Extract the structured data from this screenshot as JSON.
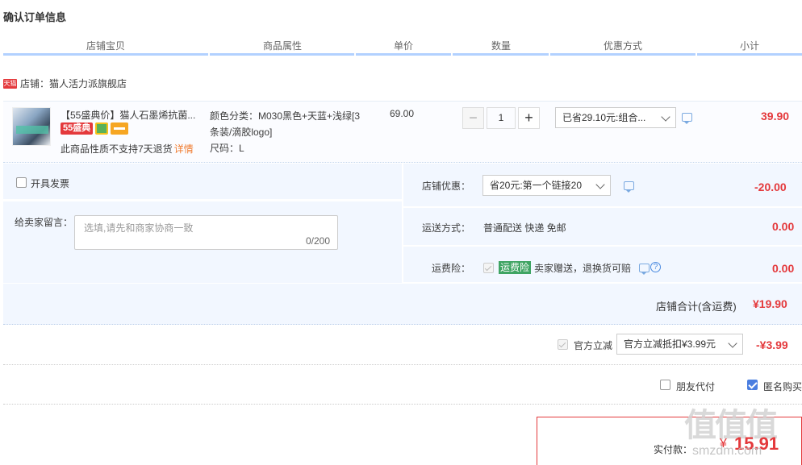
{
  "page_title": "确认订单信息",
  "columns": [
    "店铺宝贝",
    "商品属性",
    "单价",
    "数量",
    "优惠方式",
    "小计"
  ],
  "shop": {
    "icon_text": "天猫",
    "label": "店铺：猫人活力派旗舰店"
  },
  "item": {
    "title": "【55盛典价】猫人石墨烯抗菌...",
    "badge": "55盛典",
    "no_return": "此商品性质不支持7天退货",
    "detail_link": "详情",
    "attr_color": "颜色分类：M030黑色+天蓝+浅绿[3条装/滴胶logo]",
    "attr_size": "尺码：L",
    "price": "69.00",
    "quantity": "1",
    "qty_minus": "−",
    "qty_plus": "+",
    "discount_select": "已省29.10元:组合...",
    "subtotal": "39.90"
  },
  "invoice": {
    "label": "开具发票"
  },
  "message": {
    "label": "给卖家留言：",
    "placeholder": "选填,请先和商家协商一致",
    "counter": "0/200"
  },
  "store_discount": {
    "label": "店铺优惠：",
    "select": "省20元:第一个链接20",
    "amount": "-20.00"
  },
  "shipping": {
    "label": "运送方式：",
    "value": "普通配送 快递 免邮",
    "amount": "0.00"
  },
  "freight_insurance": {
    "label": "运费险：",
    "tag": "运费险",
    "text": "卖家赠送，退换货可赔",
    "help": "?",
    "amount": "0.00"
  },
  "shop_total": {
    "label": "店铺合计(含运费)",
    "amount": "¥19.90"
  },
  "official_discount": {
    "label": "官方立减",
    "select": "官方立减抵扣¥3.99元",
    "amount": "-¥3.99"
  },
  "options": {
    "friend_pay": "朋友代付",
    "anonymous": "匿名购买"
  },
  "payment": {
    "label": "实付款：",
    "currency": "¥",
    "amount": "15.91"
  },
  "watermark": {
    "text": "值值值",
    "sub": "smzdm.com"
  },
  "colors": {
    "accent_red": "#e4393c",
    "header_bar": "#b2d1ff",
    "panel_bg": "#f2f7ff",
    "freight_green": "#3fa463"
  }
}
